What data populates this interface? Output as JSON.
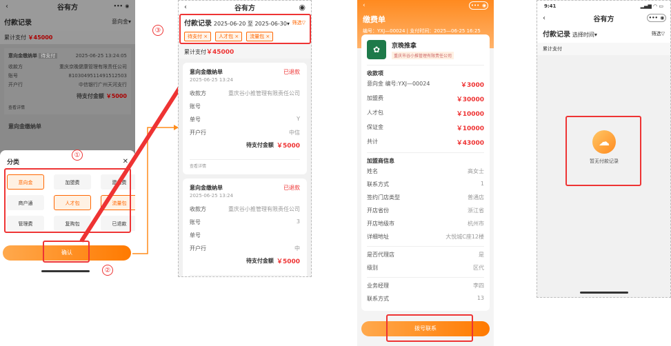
{
  "screen1": {
    "nav_title": "谷有方",
    "page_title": "付款记录",
    "filter_label": "意向金",
    "summary_label": "累计支付",
    "summary_amount": "￥45000",
    "order_title": "意向金缴纳单",
    "order_badge": "待支付",
    "order_time": "2025-06-25 13:24:05",
    "rows": [
      {
        "label": "收款方",
        "value": "重庆京晚健康管理有限责任公司"
      },
      {
        "label": "账号",
        "value": "8103049511491512503"
      },
      {
        "label": "开户行",
        "value": "中信银行广州天河支行"
      }
    ],
    "due_label": "待支付金额",
    "due_amount": "￥5000",
    "detail_link": "查看详情",
    "order2_title": "意向金缴纳单",
    "sheet_title": "分类",
    "sheet_close": "✕",
    "categories": [
      "意向金",
      "加盟费",
      "建店费",
      "商户通",
      "人才包",
      "流量包",
      "管理费",
      "复购包",
      "已退款"
    ],
    "confirm_label": "确认",
    "marker1": "①",
    "marker2": "②"
  },
  "screen2": {
    "nav_title": "谷有方",
    "page_title": "付款记录",
    "date_from": "2025-06-20",
    "date_sep": "至",
    "date_to": "2025-06-30",
    "filter_label": "筛选",
    "tags": [
      "待支付",
      "人才包",
      "流量包"
    ],
    "summary_label": "累计支付",
    "summary_amount": "￥45000",
    "marker3": "③",
    "orders": [
      {
        "title": "意向金缴纳单",
        "status": "已退款",
        "time": "2025-06-25 13:24",
        "rows": [
          {
            "label": "收款方",
            "value": "重庆谷小推管理有限责任公司"
          },
          {
            "label": "账号",
            "value": ""
          },
          {
            "label": "单号",
            "value": "Y"
          },
          {
            "label": "开户行",
            "value": "中信"
          }
        ],
        "due_label": "待支付金额",
        "due_amount": "￥5000",
        "link": "查看详情"
      },
      {
        "title": "意向金缴纳单",
        "status": "已退款",
        "time": "2025-06-25 13:24",
        "rows": [
          {
            "label": "收款方",
            "value": "重庆谷小推管理有限责任公司"
          },
          {
            "label": "账号",
            "value": "3"
          },
          {
            "label": "单号",
            "value": ""
          },
          {
            "label": "开户行",
            "value": "中"
          }
        ],
        "due_label": "待支付金额",
        "due_amount": "￥5000",
        "link": "查看详情"
      }
    ]
  },
  "screen3": {
    "title": "缴费单",
    "order_no": "编号：YXJ—00024",
    "pay_time": "支付时间：2025—06-25 16:25",
    "brand_name": "京晚推拿",
    "company": "重庆市谷小推管理有限责任公司",
    "section_items": "收款项",
    "items": [
      {
        "label": "意向金 编号:YXJ—00024",
        "value": "￥3000"
      },
      {
        "label": "加盟费",
        "value": "￥30000"
      },
      {
        "label": "人才包",
        "value": "￥10000"
      },
      {
        "label": "保证金",
        "value": "￥10000"
      },
      {
        "label": "共计",
        "value": "￥43000"
      }
    ],
    "section_info": "加盟商信息",
    "info": [
      {
        "label": "姓名",
        "value": "高女士"
      },
      {
        "label": "联系方式",
        "value": "1"
      },
      {
        "label": "签约门店类型",
        "value": "普通店"
      },
      {
        "label": "开店省份",
        "value": "浙江省"
      },
      {
        "label": "开店地级市",
        "value": "杭州市"
      },
      {
        "label": "详细地址",
        "value": "大悦城C座12楼"
      }
    ],
    "info2": [
      {
        "label": "是否代理店",
        "value": "是"
      },
      {
        "label": "级别",
        "value": "区代"
      }
    ],
    "info3": [
      {
        "label": "业务经理",
        "value": "李四"
      },
      {
        "label": "联系方式",
        "value": "13"
      }
    ],
    "call_label": "拨号联系"
  },
  "screen4": {
    "time": "9:41",
    "nav_title": "谷有方",
    "page_title": "付款记录",
    "time_filter": "选择时间",
    "filter_label": "筛选",
    "summary_label": "累计支付",
    "empty_text": "暂无付款记录"
  },
  "colors": {
    "accent": "#ff7a00",
    "mark": "#e33333"
  }
}
